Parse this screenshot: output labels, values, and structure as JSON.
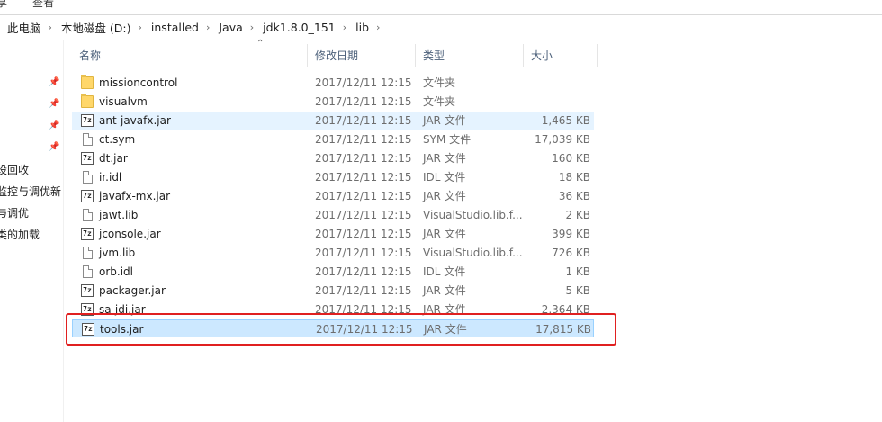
{
  "ribbon": {
    "tab_share": "享",
    "tab_view": "查看"
  },
  "breadcrumb": [
    "此电脑",
    "本地磁盘 (D:)",
    "installed",
    "Java",
    "jdk1.8.0_151",
    "lib"
  ],
  "nav": {
    "items": [
      "设回收",
      "监控与调优新",
      "与调优",
      "类的加载"
    ]
  },
  "columns": {
    "name": "名称",
    "date": "修改日期",
    "type": "类型",
    "size": "大小"
  },
  "files": [
    {
      "name": "missioncontrol",
      "date": "2017/12/11 12:15",
      "type": "文件夹",
      "size": "",
      "icon": "folder-icon"
    },
    {
      "name": "visualvm",
      "date": "2017/12/11 12:15",
      "type": "文件夹",
      "size": "",
      "icon": "folder-icon"
    },
    {
      "name": "ant-javafx.jar",
      "date": "2017/12/11 12:15",
      "type": "JAR 文件",
      "size": "1,465 KB",
      "icon": "jar-icon"
    },
    {
      "name": "ct.sym",
      "date": "2017/12/11 12:15",
      "type": "SYM 文件",
      "size": "17,039 KB",
      "icon": "file-icon"
    },
    {
      "name": "dt.jar",
      "date": "2017/12/11 12:15",
      "type": "JAR 文件",
      "size": "160 KB",
      "icon": "jar-icon"
    },
    {
      "name": "ir.idl",
      "date": "2017/12/11 12:15",
      "type": "IDL 文件",
      "size": "18 KB",
      "icon": "file-icon"
    },
    {
      "name": "javafx-mx.jar",
      "date": "2017/12/11 12:15",
      "type": "JAR 文件",
      "size": "36 KB",
      "icon": "jar-icon"
    },
    {
      "name": "jawt.lib",
      "date": "2017/12/11 12:15",
      "type": "VisualStudio.lib.f...",
      "size": "2 KB",
      "icon": "file-icon"
    },
    {
      "name": "jconsole.jar",
      "date": "2017/12/11 12:15",
      "type": "JAR 文件",
      "size": "399 KB",
      "icon": "jar-icon"
    },
    {
      "name": "jvm.lib",
      "date": "2017/12/11 12:15",
      "type": "VisualStudio.lib.f...",
      "size": "726 KB",
      "icon": "file-icon"
    },
    {
      "name": "orb.idl",
      "date": "2017/12/11 12:15",
      "type": "IDL 文件",
      "size": "1 KB",
      "icon": "file-icon"
    },
    {
      "name": "packager.jar",
      "date": "2017/12/11 12:15",
      "type": "JAR 文件",
      "size": "5 KB",
      "icon": "jar-icon"
    },
    {
      "name": "sa-jdi.jar",
      "date": "2017/12/11 12:15",
      "type": "JAR 文件",
      "size": "2,364 KB",
      "icon": "jar-icon"
    },
    {
      "name": "tools.jar",
      "date": "2017/12/11 12:15",
      "type": "JAR 文件",
      "size": "17,815 KB",
      "icon": "jar-icon"
    }
  ],
  "jar_icon_glyph": "7z",
  "selected_file": "tools.jar",
  "hover_file": "ant-javafx.jar",
  "colors": {
    "selection_bg": "#cce8ff",
    "hover_bg": "#e5f3ff",
    "highlight_box": "#e02020",
    "folder": "#ffd76a"
  }
}
